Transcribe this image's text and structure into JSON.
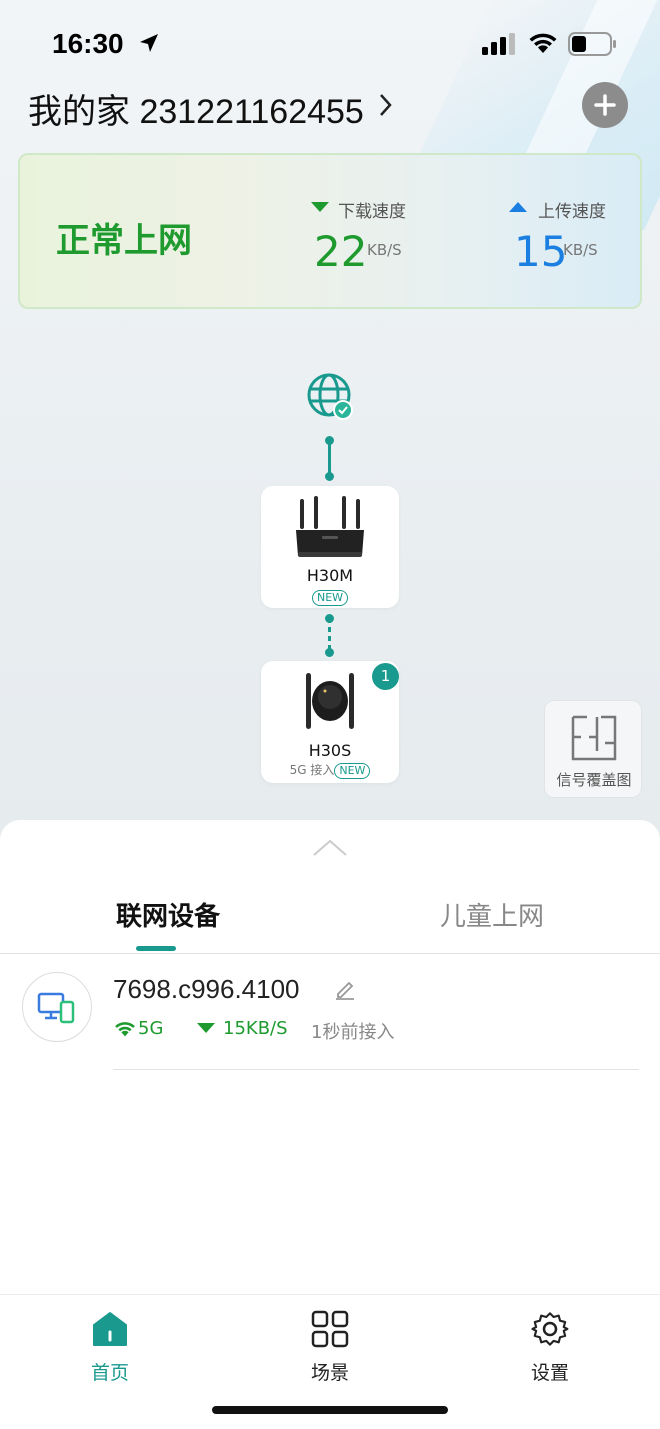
{
  "status_bar": {
    "time": "16:30"
  },
  "header": {
    "home_title": "我的家 231221162455"
  },
  "net_card": {
    "status": "正常上网",
    "download_label": "下载速度",
    "download_value": "22",
    "download_unit": "KB/S",
    "upload_label": "上传速度",
    "upload_value": "15",
    "upload_unit": "KB/S"
  },
  "topology": {
    "router": {
      "name": "H30M",
      "badge": "NEW"
    },
    "extender": {
      "name": "H30S",
      "access": "5G 接入",
      "badge": "NEW",
      "client_count": "1"
    }
  },
  "coverage": {
    "label": "信号覆盖图"
  },
  "tabs": [
    {
      "label": "联网设备"
    },
    {
      "label": "儿童上网"
    }
  ],
  "devices": [
    {
      "name": "7698.c996.4100",
      "band": "5G",
      "speed": "15KB/S",
      "joined": "1秒前接入"
    }
  ],
  "bottom_nav": [
    {
      "label": "首页"
    },
    {
      "label": "场景"
    },
    {
      "label": "设置"
    }
  ],
  "colors": {
    "accent": "#1a9a8e",
    "status_green": "#1e9a2e",
    "upload_blue": "#1a7fe0"
  },
  "icons": [
    "location-arrow-icon",
    "cellular-signal-icon",
    "wifi-icon",
    "battery-icon",
    "chevron-right-icon",
    "plus-icon",
    "globe-icon",
    "check-icon",
    "router-icon",
    "extender-icon",
    "floorplan-icon",
    "chevron-up-icon",
    "devices-icon",
    "edit-icon",
    "home-icon",
    "grid-icon",
    "gear-icon"
  ]
}
